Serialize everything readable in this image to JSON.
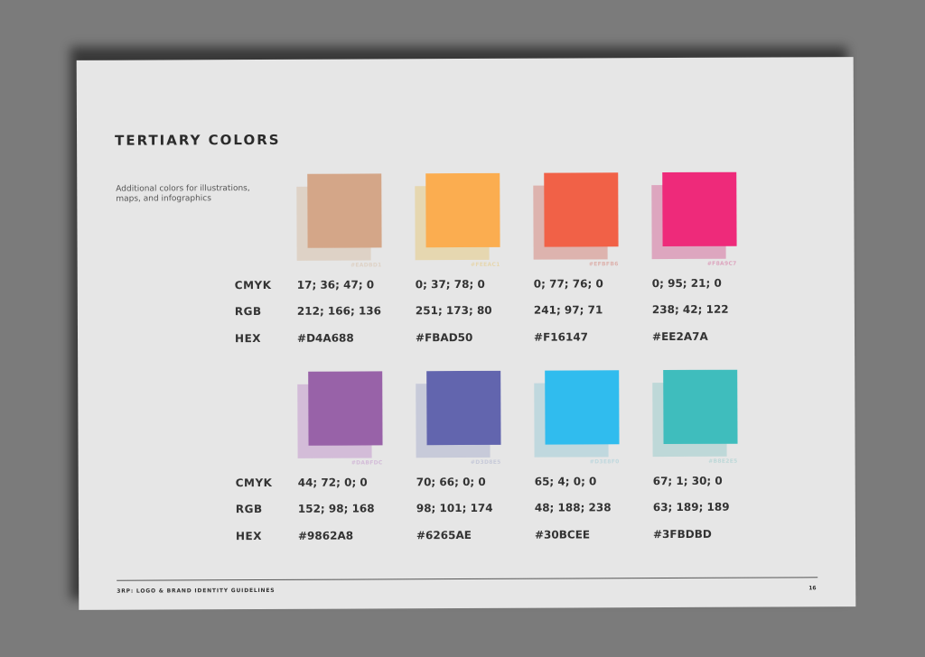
{
  "title": "TERTIARY COLORS",
  "description": "Additional colors for illustrations, maps, and infographics",
  "labels": {
    "cmyk": "CMYK",
    "rgb": "RGB",
    "hex": "HEX"
  },
  "colors": [
    {
      "main": "#D4A688",
      "ghost": "#DED2C6",
      "ghost_hex": "#EADBD1",
      "cmyk": "17; 36; 47; 0",
      "rgb": "212; 166; 136",
      "hex": "#D4A688"
    },
    {
      "main": "#FBAD50",
      "ghost": "#E6D7B0",
      "ghost_hex": "#FEEAC1",
      "cmyk": "0; 37; 78; 0",
      "rgb": "251; 173; 80",
      "hex": "#FBAD50"
    },
    {
      "main": "#F16147",
      "ghost": "#DDB3AE",
      "ghost_hex": "#EFBFB6",
      "cmyk": "0; 77; 76; 0",
      "rgb": "241; 97; 71",
      "hex": "#F16147"
    },
    {
      "main": "#EE2A7A",
      "ghost": "#DDA6BF",
      "ghost_hex": "#F8A9C7",
      "cmyk": "0; 95; 21; 0",
      "rgb": "238; 42; 122",
      "hex": "#EE2A7A"
    },
    {
      "main": "#9862A8",
      "ghost": "#D3BCD8",
      "ghost_hex": "#DABFDC",
      "cmyk": "44; 72; 0; 0",
      "rgb": "152; 98; 168",
      "hex": "#9862A8"
    },
    {
      "main": "#6265AE",
      "ghost": "#C7CAD9",
      "ghost_hex": "#D3D8E5",
      "cmyk": "70; 66; 0; 0",
      "rgb": "98; 101; 174",
      "hex": "#6265AE"
    },
    {
      "main": "#30BCEE",
      "ghost": "#C0D8DE",
      "ghost_hex": "#D3E8F0",
      "cmyk": "65; 4; 0; 0",
      "rgb": "48; 188; 238",
      "hex": "#30BCEE"
    },
    {
      "main": "#3FBDBD",
      "ghost": "#BED8D8",
      "ghost_hex": "#B8E2E5",
      "cmyk": "67; 1; 30; 0",
      "rgb": "63; 189; 189",
      "hex": "#3FBDBD"
    }
  ],
  "footer": {
    "text": "3RP: LOGO & BRAND IDENTITY GUIDELINES",
    "page_number": "16"
  }
}
